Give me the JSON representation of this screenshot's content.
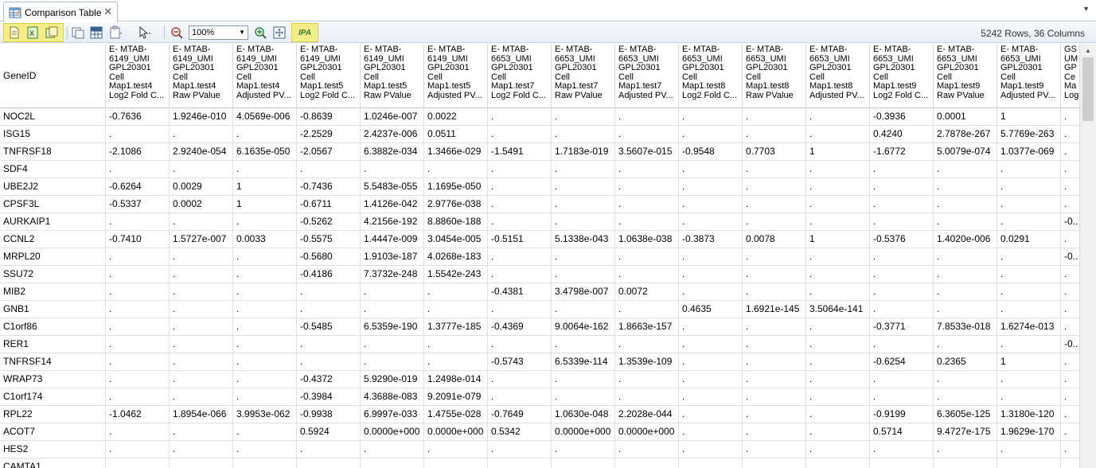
{
  "tab": {
    "title": "Comparison Table",
    "close": "✕"
  },
  "menu_arrow": "▼",
  "toolbar": {
    "zoom_value": "100%",
    "ipa_label": "IPA",
    "row_count": "5242 Rows, 36 Columns"
  },
  "columns": [
    {
      "label": "GeneID"
    },
    {
      "label": "E- MTAB-\n6149_UMI\nGPL20301\nCell\nMap1.test4\nLog2 Fold C..."
    },
    {
      "label": "E- MTAB-\n6149_UMI\nGPL20301\nCell\nMap1.test4\nRaw PValue"
    },
    {
      "label": "E- MTAB-\n6149_UMI\nGPL20301\nCell\nMap1.test4\nAdjusted PV..."
    },
    {
      "label": "E- MTAB-\n6149_UMI\nGPL20301\nCell\nMap1.test5\nLog2 Fold C..."
    },
    {
      "label": "E- MTAB-\n6149_UMI\nGPL20301\nCell\nMap1.test5\nRaw PValue"
    },
    {
      "label": "E- MTAB-\n6149_UMI\nGPL20301\nCell\nMap1.test5\nAdjusted PV..."
    },
    {
      "label": "E- MTAB-\n6653_UMI\nGPL20301\nCell\nMap1.test7\nLog2 Fold C..."
    },
    {
      "label": "E- MTAB-\n6653_UMI\nGPL20301\nCell\nMap1.test7\nRaw PValue"
    },
    {
      "label": "E- MTAB-\n6653_UMI\nGPL20301\nCell\nMap1.test7\nAdjusted PV..."
    },
    {
      "label": "E- MTAB-\n6653_UMI\nGPL20301\nCell\nMap1.test8\nLog2 Fold C..."
    },
    {
      "label": "E- MTAB-\n6653_UMI\nGPL20301\nCell\nMap1.test8\nRaw PValue"
    },
    {
      "label": "E- MTAB-\n6653_UMI\nGPL20301\nCell\nMap1.test8\nAdjusted PV..."
    },
    {
      "label": "E- MTAB-\n6653_UMI\nGPL20301\nCell\nMap1.test9\nLog2 Fold C..."
    },
    {
      "label": "E- MTAB-\n6653_UMI\nGPL20301\nCell\nMap1.test9\nRaw PValue"
    },
    {
      "label": "E- MTAB-\n6653_UMI\nGPL20301\nCell\nMap1.test9\nAdjusted PV..."
    },
    {
      "label": "GS\nUM\nGP\nCe\nMa\nLog"
    }
  ],
  "rows": [
    [
      "NOC2L",
      "-0.7636",
      "1.9246e-010",
      "4.0569e-006",
      "-0.8639",
      "1.0246e-007",
      "0.0022",
      ".",
      ".",
      ".",
      ".",
      ".",
      ".",
      "-0.3936",
      "0.0001",
      "1",
      "."
    ],
    [
      "ISG15",
      ".",
      ".",
      ".",
      "-2.2529",
      "2.4237e-006",
      "0.0511",
      ".",
      ".",
      ".",
      ".",
      ".",
      ".",
      "0.4240",
      "2.7878e-267",
      "5.7769e-263",
      "."
    ],
    [
      "TNFRSF18",
      "-2.1086",
      "2.9240e-054",
      "6.1635e-050",
      "-2.0567",
      "6.3882e-034",
      "1.3466e-029",
      "-1.5491",
      "1.7183e-019",
      "3.5607e-015",
      "-0.9548",
      "0.7703",
      "1",
      "-1.6772",
      "5.0079e-074",
      "1.0377e-069",
      "."
    ],
    [
      "SDF4",
      ".",
      ".",
      ".",
      ".",
      ".",
      ".",
      ".",
      ".",
      ".",
      ".",
      ".",
      ".",
      ".",
      ".",
      ".",
      "."
    ],
    [
      "UBE2J2",
      "-0.6264",
      "0.0029",
      "1",
      "-0.7436",
      "5.5483e-055",
      "1.1695e-050",
      ".",
      ".",
      ".",
      ".",
      ".",
      ".",
      ".",
      ".",
      ".",
      "."
    ],
    [
      "CPSF3L",
      "-0.5337",
      "0.0002",
      "1",
      "-0.6711",
      "1.4126e-042",
      "2.9776e-038",
      ".",
      ".",
      ".",
      ".",
      ".",
      ".",
      ".",
      ".",
      ".",
      "."
    ],
    [
      "AURKAIP1",
      ".",
      ".",
      ".",
      "-0.5262",
      "4.2156e-192",
      "8.8860e-188",
      ".",
      ".",
      ".",
      ".",
      ".",
      ".",
      ".",
      ".",
      ".",
      "-0.."
    ],
    [
      "CCNL2",
      "-0.7410",
      "1.5727e-007",
      "0.0033",
      "-0.5575",
      "1.4447e-009",
      "3.0454e-005",
      "-0.5151",
      "5.1338e-043",
      "1.0638e-038",
      "-0.3873",
      "0.0078",
      "1",
      "-0.5376",
      "1.4020e-006",
      "0.0291",
      "."
    ],
    [
      "MRPL20",
      ".",
      ".",
      ".",
      "-0.5680",
      "1.9103e-187",
      "4.0268e-183",
      ".",
      ".",
      ".",
      ".",
      ".",
      ".",
      ".",
      ".",
      ".",
      "-0.."
    ],
    [
      "SSU72",
      ".",
      ".",
      ".",
      "-0.4186",
      "7.3732e-248",
      "1.5542e-243",
      ".",
      ".",
      ".",
      ".",
      ".",
      ".",
      ".",
      ".",
      ".",
      "."
    ],
    [
      "MIB2",
      ".",
      ".",
      ".",
      ".",
      ".",
      ".",
      "-0.4381",
      "3.4798e-007",
      "0.0072",
      ".",
      ".",
      ".",
      ".",
      ".",
      ".",
      "."
    ],
    [
      "GNB1",
      ".",
      ".",
      ".",
      ".",
      ".",
      ".",
      ".",
      ".",
      ".",
      "0.4635",
      "1.6921e-145",
      "3.5064e-141",
      ".",
      ".",
      ".",
      "."
    ],
    [
      "C1orf86",
      ".",
      ".",
      ".",
      "-0.5485",
      "6.5359e-190",
      "1.3777e-185",
      "-0.4369",
      "9.0064e-162",
      "1.8663e-157",
      ".",
      ".",
      ".",
      "-0.3771",
      "7.8533e-018",
      "1.6274e-013",
      "."
    ],
    [
      "RER1",
      ".",
      ".",
      ".",
      ".",
      ".",
      ".",
      ".",
      ".",
      ".",
      ".",
      ".",
      ".",
      ".",
      ".",
      ".",
      "-0.."
    ],
    [
      "TNFRSF14",
      ".",
      ".",
      ".",
      ".",
      ".",
      ".",
      "-0.5743",
      "6.5339e-114",
      "1.3539e-109",
      ".",
      ".",
      ".",
      "-0.6254",
      "0.2365",
      "1",
      "."
    ],
    [
      "WRAP73",
      ".",
      ".",
      ".",
      "-0.4372",
      "5.9290e-019",
      "1.2498e-014",
      ".",
      ".",
      ".",
      ".",
      ".",
      ".",
      ".",
      ".",
      ".",
      "."
    ],
    [
      "C1orf174",
      ".",
      ".",
      ".",
      "-0.3984",
      "4.3688e-083",
      "9.2091e-079",
      ".",
      ".",
      ".",
      ".",
      ".",
      ".",
      ".",
      ".",
      ".",
      "."
    ],
    [
      "RPL22",
      "-1.0462",
      "1.8954e-066",
      "3.9953e-062",
      "-0.9938",
      "6.9997e-033",
      "1.4755e-028",
      "-0.7649",
      "1.0630e-048",
      "2.2028e-044",
      ".",
      ".",
      ".",
      "-0.9199",
      "6.3605e-125",
      "1.3180e-120",
      "."
    ],
    [
      "ACOT7",
      ".",
      ".",
      ".",
      "0.5924",
      "0.0000e+000",
      "0.0000e+000",
      "0.5342",
      "0.0000e+000",
      "0.0000e+000",
      ".",
      ".",
      ".",
      "0.5714",
      "9.4727e-175",
      "1.9629e-170",
      "."
    ],
    [
      "HES2",
      ".",
      ".",
      ".",
      ".",
      ".",
      ".",
      ".",
      ".",
      ".",
      ".",
      ".",
      ".",
      ".",
      ".",
      ".",
      "."
    ],
    [
      "CAMTA1",
      "",
      "",
      "",
      "",
      "",
      "",
      "",
      "",
      "",
      "",
      "",
      "",
      "",
      "",
      "",
      ""
    ]
  ]
}
